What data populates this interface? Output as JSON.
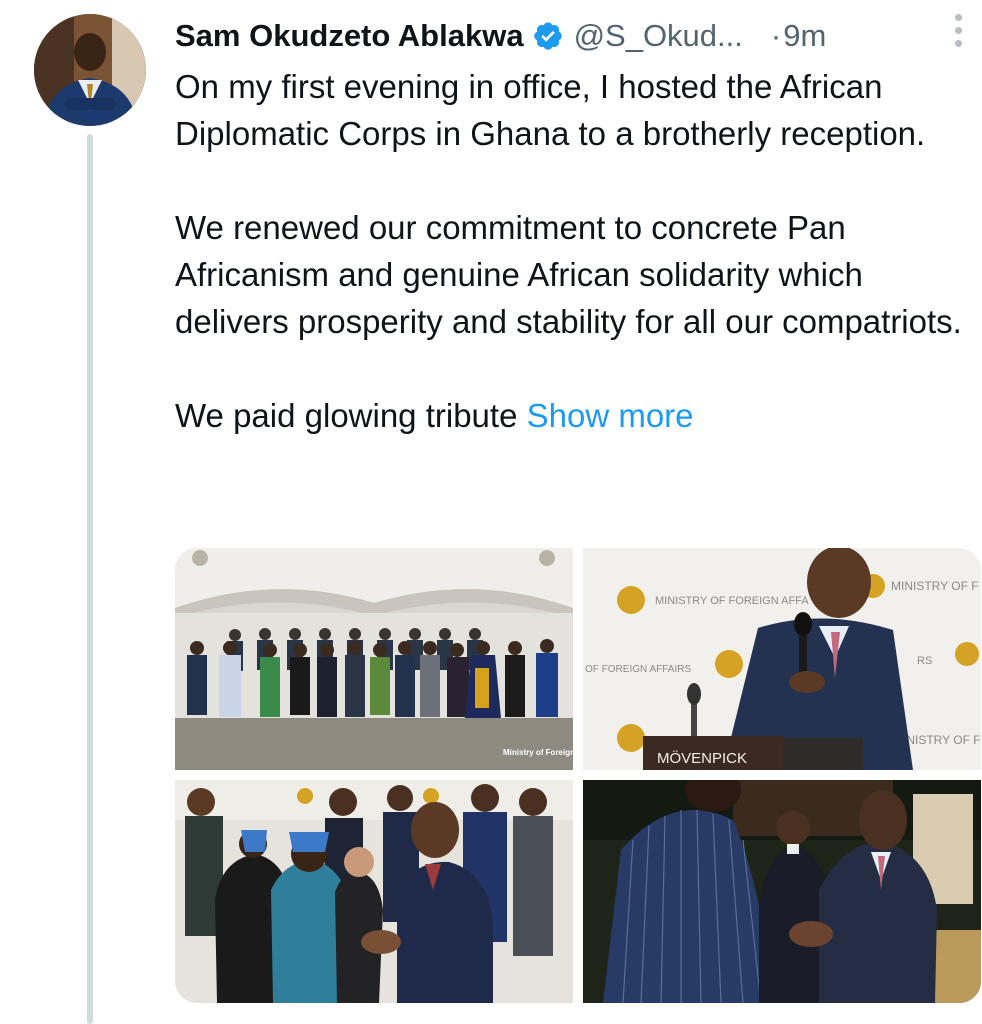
{
  "tweet": {
    "author_name": "Sam Okudzeto Ablakwa",
    "handle": "@S_Okud...",
    "separator": "·",
    "time": "9m",
    "paragraphs": [
      "On my first evening in office, I hosted the African Diplomatic Corps in Ghana to a brotherly reception.",
      "We renewed our commitment to concrete Pan Africanism and genuine African solidarity which delivers prosperity and stability for all our compatriots."
    ],
    "last_line": "We paid glowing tribute",
    "show_more": "Show more"
  },
  "media": {
    "photo1": {
      "watermark": "Ministry of Foreign Affairs"
    },
    "photo2": {
      "backdrop_texts": [
        "MINISTRY OF FOREIGN AFFA",
        "MINISTRY OF F",
        "OF FOREIGN AFFAIRS",
        "RS",
        "INISTRY OF F"
      ],
      "podium_text": "MÖVENPICK"
    }
  },
  "colors": {
    "link": "#1d9bf0",
    "muted": "#536471",
    "verified": "#1d9bf0",
    "thread_line": "#cfd9de"
  },
  "icons": {
    "verified": "verified-badge-icon",
    "more": "more-options-icon"
  }
}
